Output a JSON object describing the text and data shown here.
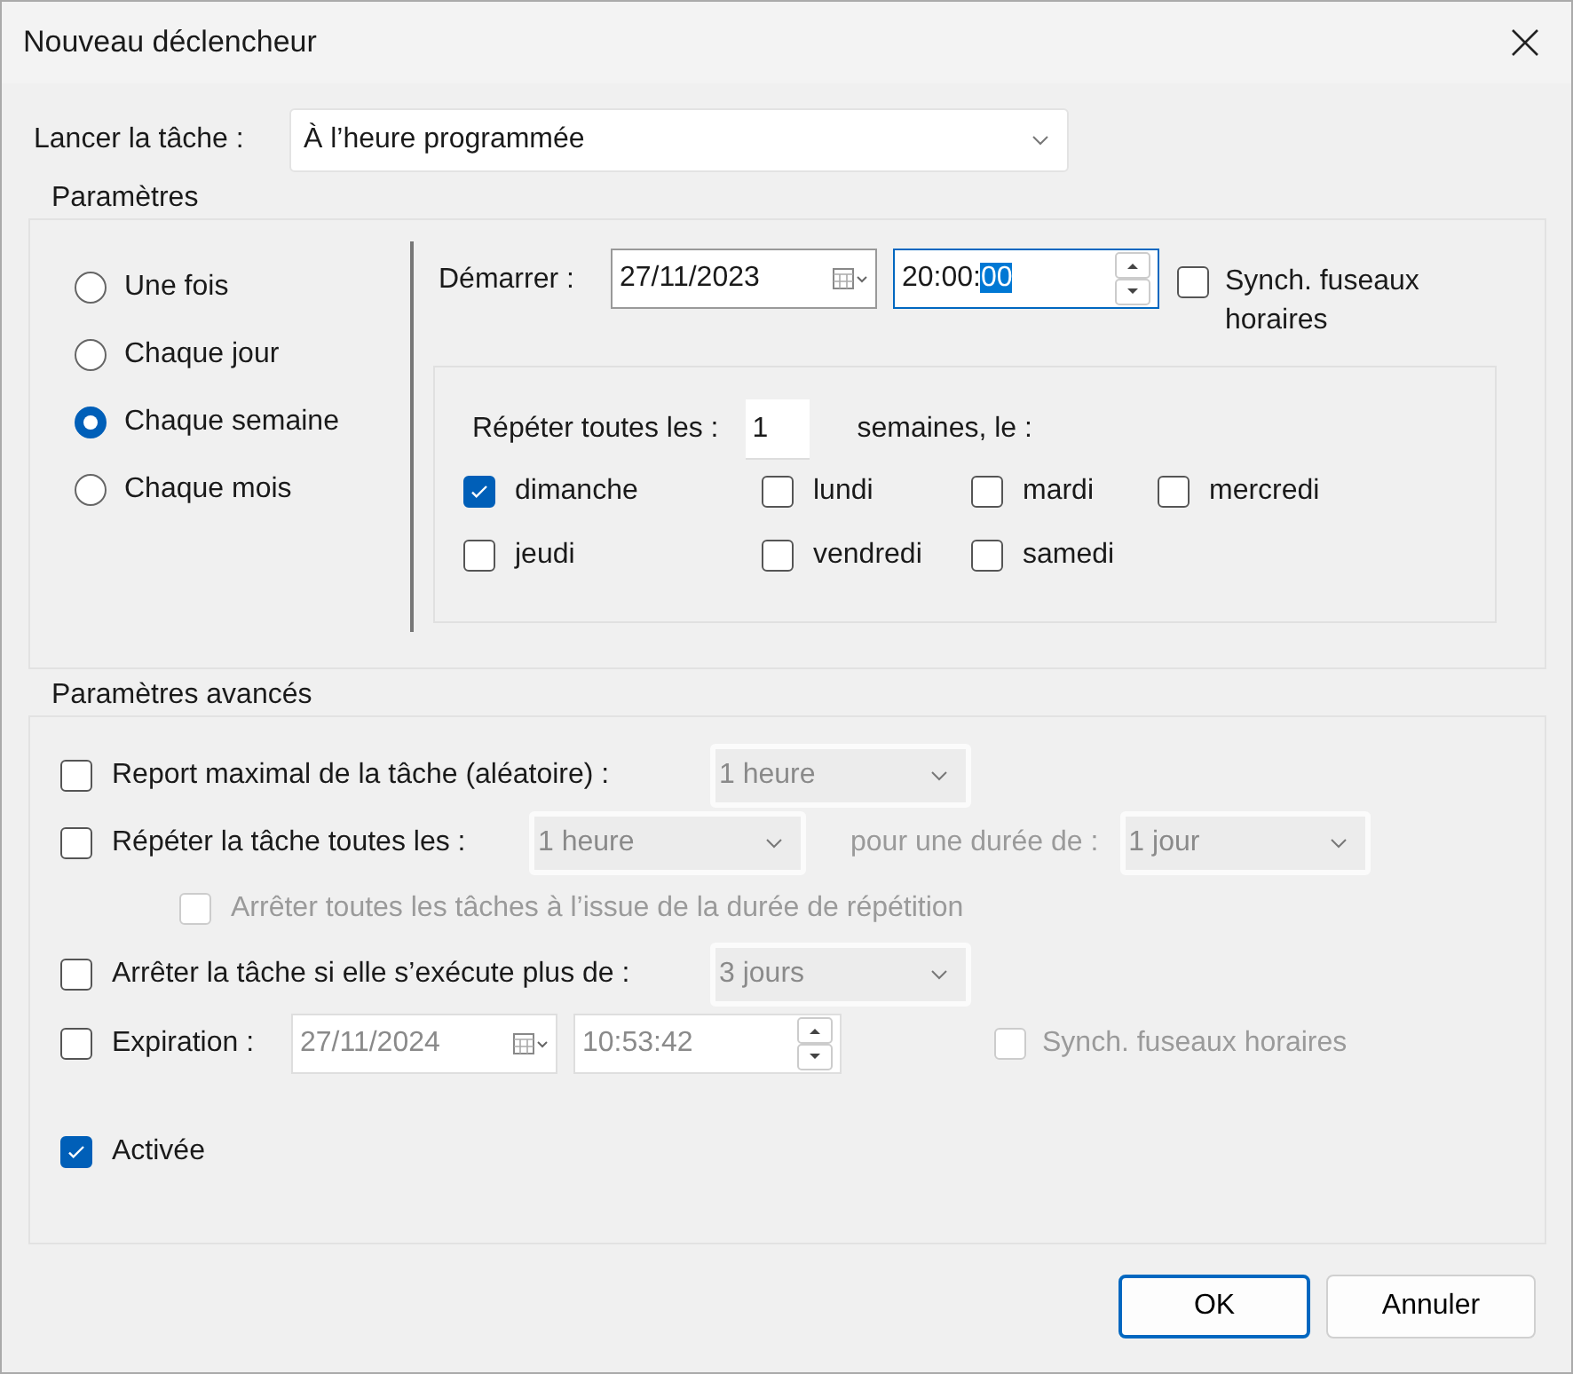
{
  "window": {
    "title": "Nouveau déclencheur"
  },
  "launch": {
    "label": "Lancer la tâche :",
    "value": "À l’heure programmée"
  },
  "settings": {
    "title": "Paramètres",
    "frequency": [
      {
        "label": "Une fois",
        "selected": false
      },
      {
        "label": "Chaque jour",
        "selected": false
      },
      {
        "label": "Chaque semaine",
        "selected": true
      },
      {
        "label": "Chaque mois",
        "selected": false
      }
    ],
    "start": {
      "label": "Démarrer :",
      "date": "27/11/2023",
      "time": "20:00:",
      "time_selected": "00"
    },
    "sync": {
      "label": "Synch. fuseaux horaires",
      "checked": false
    },
    "repeat": {
      "label": "Répéter toutes les :",
      "value": "1",
      "unit": "semaines, le :"
    },
    "days": [
      {
        "label": "dimanche",
        "checked": true
      },
      {
        "label": "lundi",
        "checked": false
      },
      {
        "label": "mardi",
        "checked": false
      },
      {
        "label": "mercredi",
        "checked": false
      },
      {
        "label": "jeudi",
        "checked": false
      },
      {
        "label": "vendredi",
        "checked": false
      },
      {
        "label": "samedi",
        "checked": false
      }
    ]
  },
  "advanced": {
    "title": "Paramètres avancés",
    "rows": [
      {
        "kind": "delay",
        "label": "Report maximal de la tâche (aléatoire) :",
        "checked": false,
        "value": "1 heure"
      },
      {
        "kind": "repeat",
        "label": "Répéter la tâche toutes les :",
        "checked": false,
        "value": "1 heure",
        "duration_label": "pour une durée de :",
        "duration": "1 jour"
      },
      {
        "kind": "sub",
        "label": "Arrêter toutes les tâches à l’issue de la durée de répétition",
        "checked": false
      },
      {
        "kind": "stop",
        "label": "Arrêter la tâche si elle s’exécute plus de :",
        "checked": false,
        "value": "3 jours"
      },
      {
        "kind": "expiration",
        "label": "Expiration :",
        "checked": false,
        "date": "27/11/2024",
        "time": "10:53:42",
        "sync_label": "Synch. fuseaux horaires",
        "sync_checked": false
      },
      {
        "kind": "enabled",
        "label": "Activée",
        "checked": true
      }
    ]
  },
  "buttons": [
    {
      "label": "OK",
      "default": true
    },
    {
      "label": "Annuler",
      "default": false
    }
  ]
}
